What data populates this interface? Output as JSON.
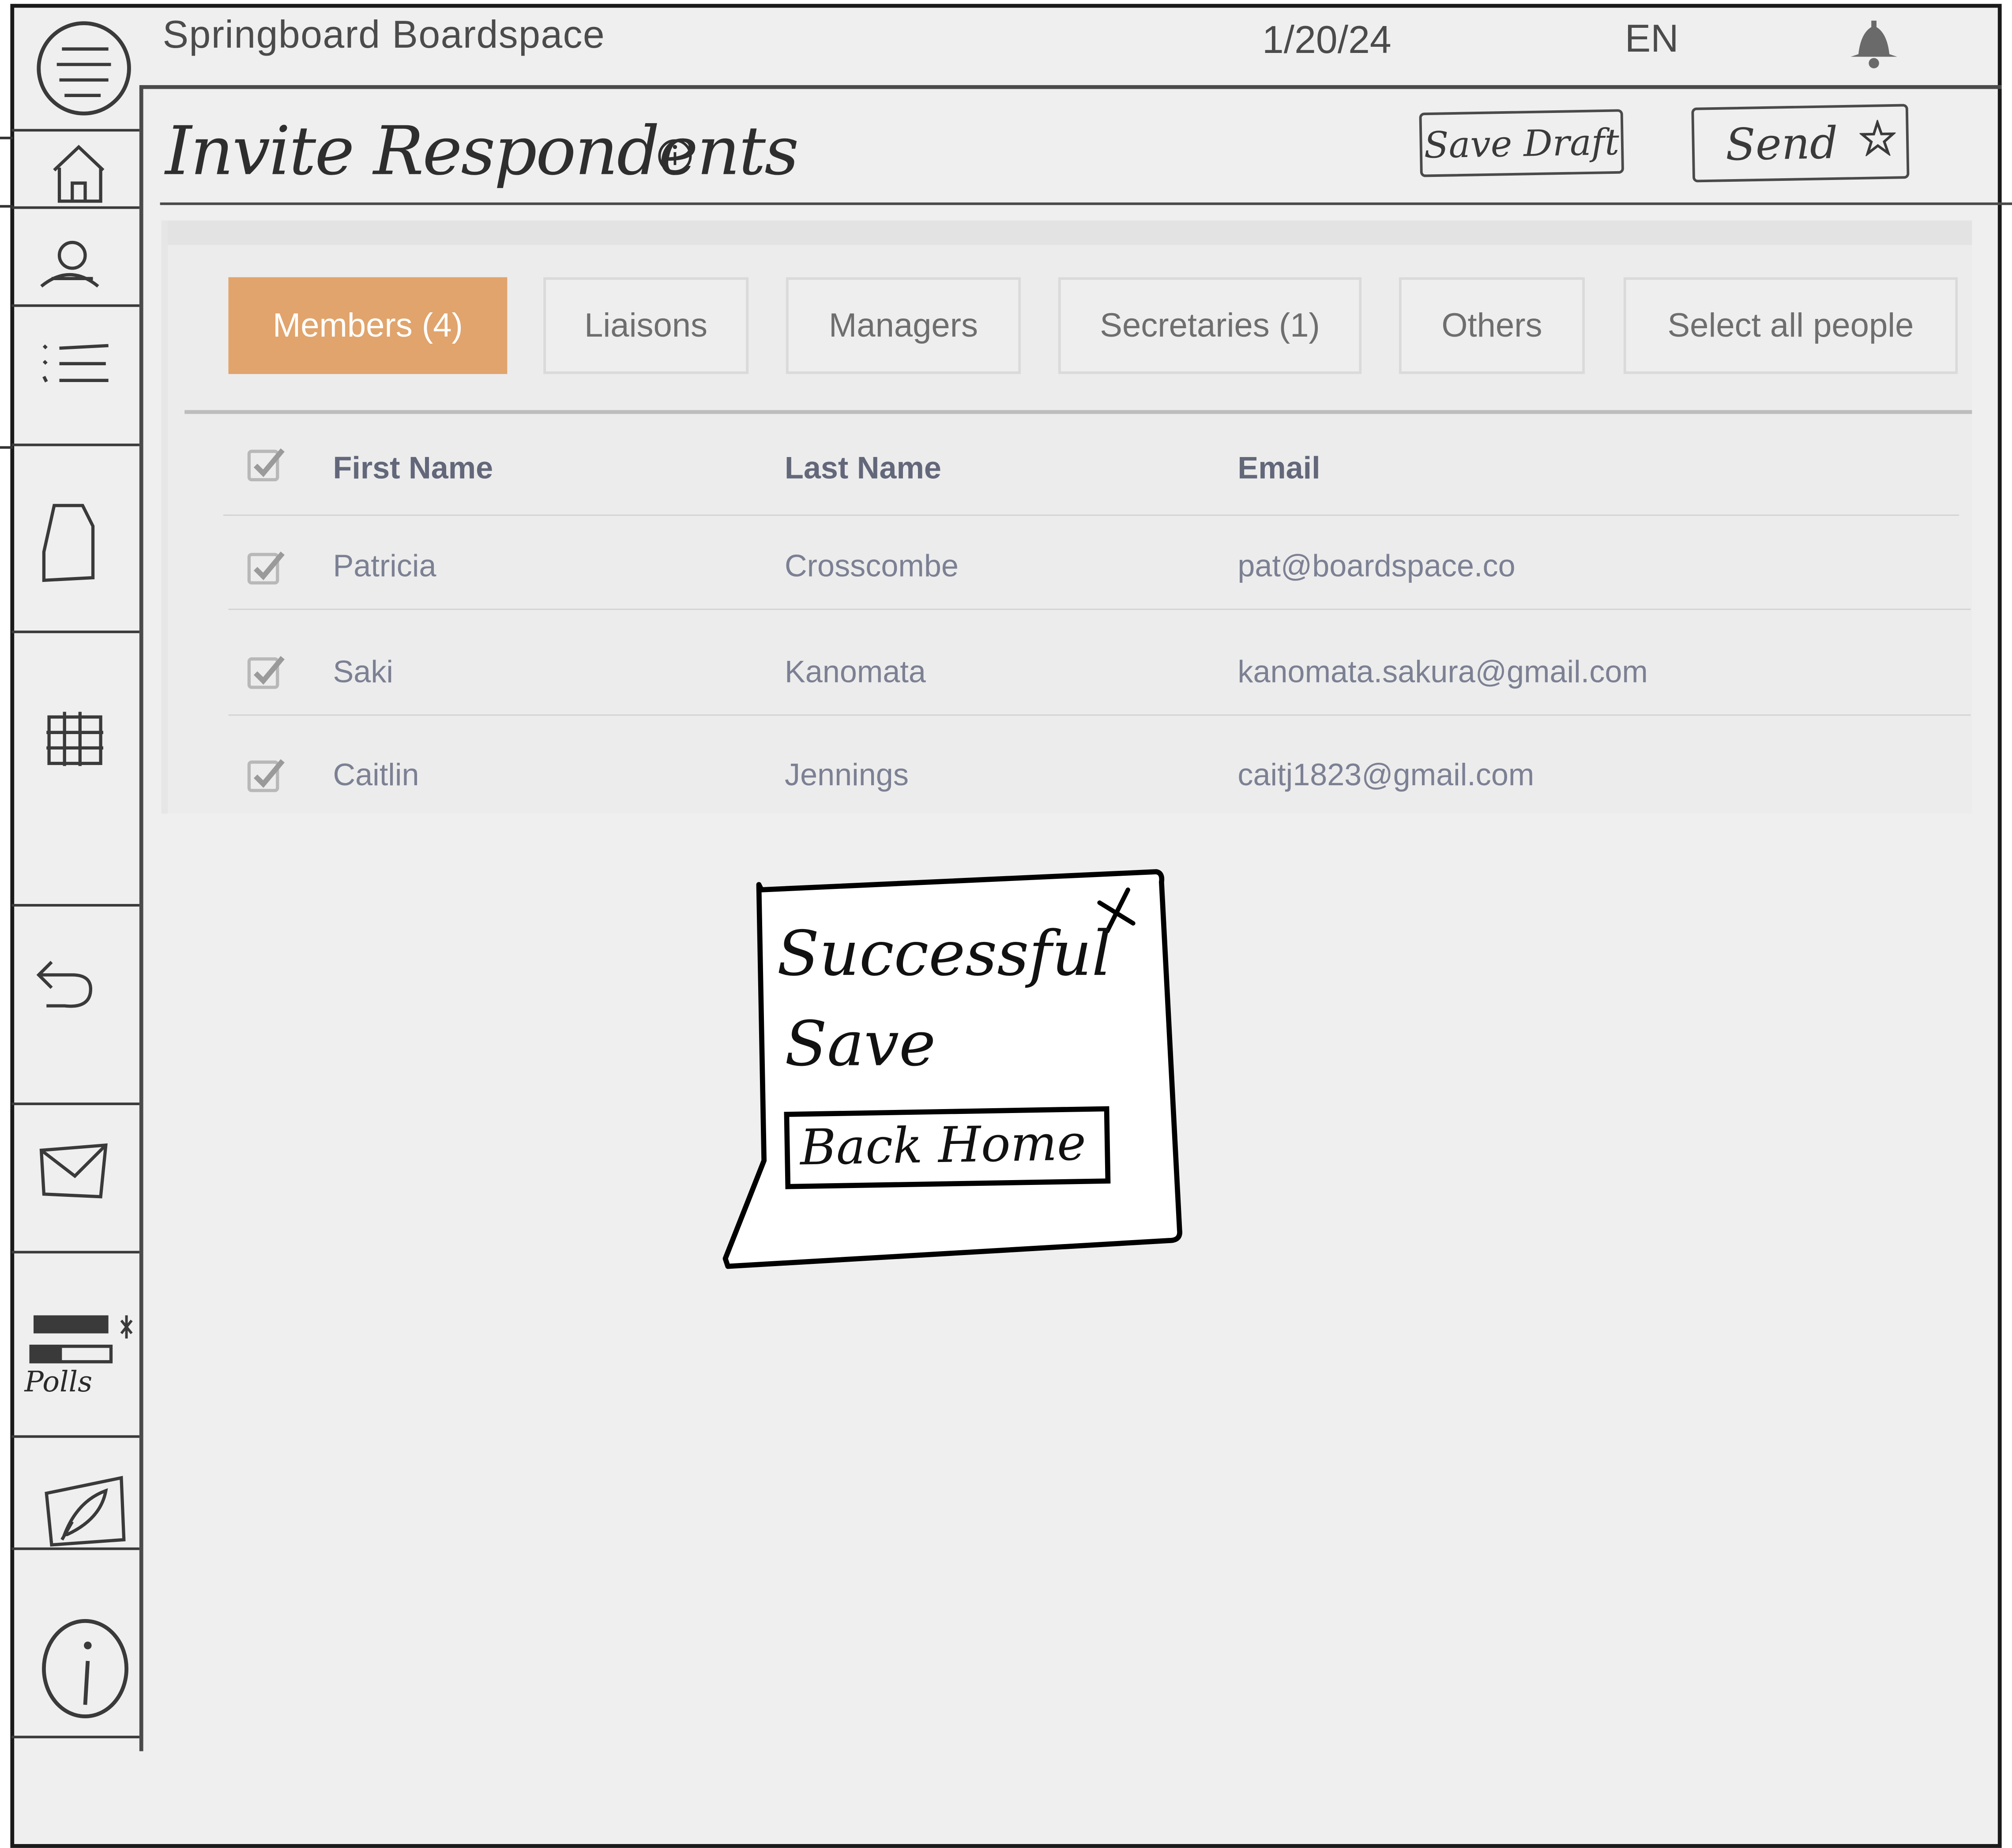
{
  "header": {
    "app_title": "Springboard Boardspace",
    "date": "1/20/24",
    "language": "EN"
  },
  "page": {
    "title": "Invite Respondents",
    "save_draft_label": "Save Draft",
    "send_label": "Send"
  },
  "tabs": [
    {
      "label": "Members (4)",
      "active": true
    },
    {
      "label": "Liaisons",
      "active": false
    },
    {
      "label": "Managers",
      "active": false
    },
    {
      "label": "Secretaries (1)",
      "active": false
    },
    {
      "label": "Others",
      "active": false
    },
    {
      "label": "Select all people",
      "active": false
    }
  ],
  "table": {
    "columns": [
      "First Name",
      "Last Name",
      "Email"
    ],
    "rows": [
      {
        "first": "Patricia",
        "last": "Crosscombe",
        "email": "pat@boardspace.co",
        "checked": true
      },
      {
        "first": "Saki",
        "last": "Kanomata",
        "email": "kanomata.sakura@gmail.com",
        "checked": true
      },
      {
        "first": "Caitlin",
        "last": "Jennings",
        "email": "caitj1823@gmail.com",
        "checked": true
      }
    ]
  },
  "modal": {
    "message_line1": "Successful",
    "message_line2": "Save",
    "back_home_label": "Back Home"
  },
  "sidebar": {
    "items": [
      {
        "icon": "menu-icon"
      },
      {
        "icon": "home-icon"
      },
      {
        "icon": "user-icon"
      },
      {
        "icon": "list-icon"
      },
      {
        "icon": "document-icon"
      },
      {
        "icon": "grid-icon"
      },
      {
        "icon": "undo-icon"
      },
      {
        "icon": "mail-icon"
      },
      {
        "icon": "polls-icon",
        "label": "Polls"
      },
      {
        "icon": "edit-icon"
      },
      {
        "icon": "info-icon"
      }
    ]
  },
  "colors": {
    "accent": "#e0a46c",
    "background": "#efefef",
    "text_muted": "#7c8093"
  }
}
